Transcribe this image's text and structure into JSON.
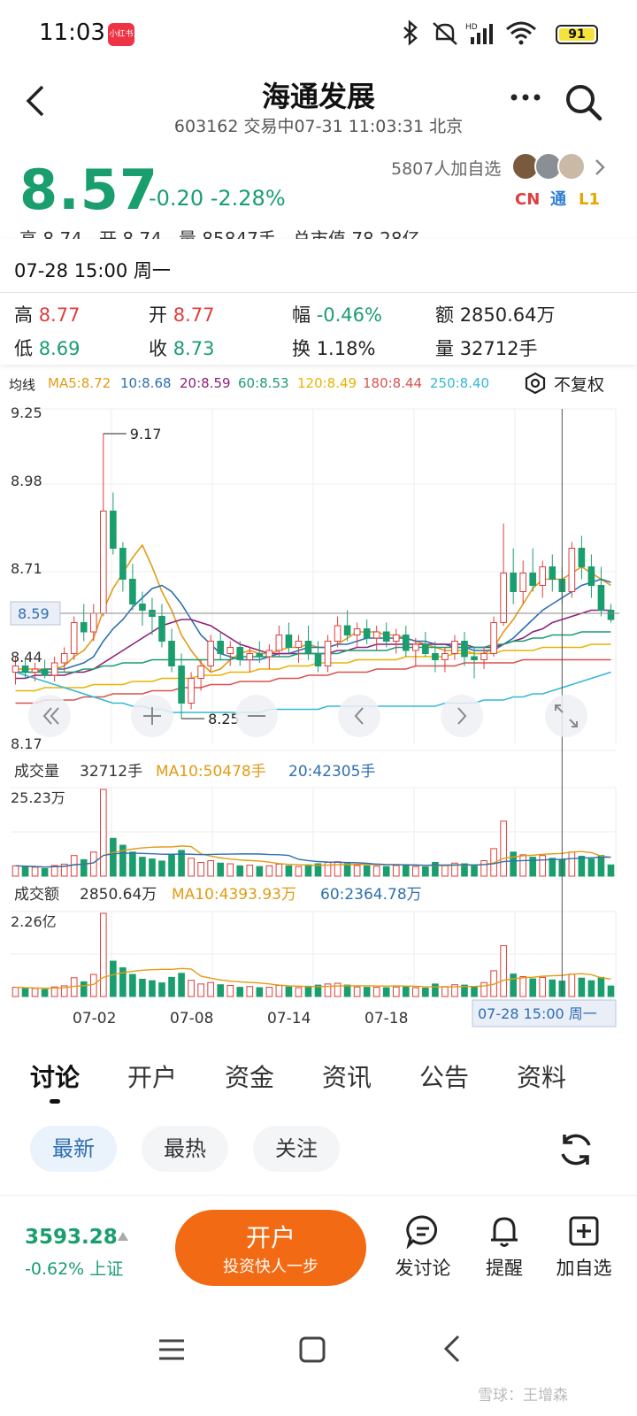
{
  "status_bar": {
    "time": "11:03",
    "app_badge": "小红书",
    "battery": "91"
  },
  "header": {
    "stock_name": "海通发展",
    "subtitle": "603162 交易中07-31 11:03:31 北京"
  },
  "quote": {
    "price": "8.57",
    "change": "-0.20 -2.28%",
    "followers": "5807人加自选",
    "tags": [
      "CN",
      "通",
      "L1"
    ],
    "partial_row": "高 8.74   开 8.74   量 85847手   总市值 78.28亿"
  },
  "info_panel": {
    "date": "07-28 15:00 周一",
    "cells": [
      {
        "label": "高",
        "value": "8.77"
      },
      {
        "label": "开",
        "value": "8.77"
      },
      {
        "label": "幅",
        "value": "-0.46%"
      },
      {
        "label": "额",
        "value": "2850.64万"
      },
      {
        "label": "低",
        "value": "8.69"
      },
      {
        "label": "收",
        "value": "8.73"
      },
      {
        "label": "换",
        "value": "1.18%"
      },
      {
        "label": "量",
        "value": "32712手"
      }
    ]
  },
  "ma_legend": {
    "title": "均线",
    "items": [
      {
        "text": "MA5:8.72",
        "color": "#e39b13"
      },
      {
        "text": "10:8.68",
        "color": "#2f6fb1"
      },
      {
        "text": "20:8.59",
        "color": "#8f1f7a"
      },
      {
        "text": "60:8.53",
        "color": "#1a9e6e"
      },
      {
        "text": "120:8.49",
        "color": "#e8b400"
      },
      {
        "text": "180:8.44",
        "color": "#d9534f"
      },
      {
        "text": "250:8.40",
        "color": "#33b9d6"
      }
    ],
    "adjust_label": "不复权"
  },
  "chart_data": {
    "type": "candlestick",
    "ylim": [
      8.17,
      9.25
    ],
    "y_ticks": [
      "9.25",
      "8.98",
      "8.71",
      "8.44",
      "8.17"
    ],
    "current_price_label": "8.59",
    "current_price": 8.59,
    "high_marker": {
      "label": "9.17",
      "value": 9.17
    },
    "low_marker": {
      "label": "8.25",
      "value": 8.25
    },
    "x_ticks": [
      "07-02",
      "07-08",
      "07-14",
      "07-18"
    ],
    "crosshair_label": "07-28 15:00 周一",
    "candles": [
      [
        8.4,
        8.45,
        8.36,
        8.42
      ],
      [
        8.42,
        8.44,
        8.38,
        8.4
      ],
      [
        8.4,
        8.43,
        8.37,
        8.41
      ],
      [
        8.41,
        8.44,
        8.38,
        8.39
      ],
      [
        8.39,
        8.45,
        8.37,
        8.43
      ],
      [
        8.43,
        8.48,
        8.4,
        8.46
      ],
      [
        8.46,
        8.58,
        8.44,
        8.56
      ],
      [
        8.56,
        8.62,
        8.5,
        8.53
      ],
      [
        8.53,
        8.62,
        8.5,
        8.59
      ],
      [
        8.59,
        9.17,
        8.58,
        8.92
      ],
      [
        8.92,
        8.98,
        8.78,
        8.8
      ],
      [
        8.8,
        8.82,
        8.66,
        8.7
      ],
      [
        8.7,
        8.75,
        8.6,
        8.62
      ],
      [
        8.62,
        8.66,
        8.55,
        8.6
      ],
      [
        8.6,
        8.64,
        8.52,
        8.58
      ],
      [
        8.58,
        8.62,
        8.48,
        8.5
      ],
      [
        8.5,
        8.54,
        8.4,
        8.42
      ],
      [
        8.42,
        8.46,
        8.25,
        8.3
      ],
      [
        8.3,
        8.4,
        8.28,
        8.38
      ],
      [
        8.38,
        8.44,
        8.34,
        8.42
      ],
      [
        8.42,
        8.52,
        8.4,
        8.5
      ],
      [
        8.5,
        8.53,
        8.44,
        8.46
      ],
      [
        8.46,
        8.5,
        8.42,
        8.48
      ],
      [
        8.48,
        8.5,
        8.42,
        8.44
      ],
      [
        8.44,
        8.48,
        8.4,
        8.46
      ],
      [
        8.46,
        8.5,
        8.43,
        8.45
      ],
      [
        8.45,
        8.49,
        8.41,
        8.47
      ],
      [
        8.47,
        8.55,
        8.45,
        8.52
      ],
      [
        8.52,
        8.56,
        8.46,
        8.48
      ],
      [
        8.48,
        8.52,
        8.43,
        8.5
      ],
      [
        8.5,
        8.55,
        8.44,
        8.46
      ],
      [
        8.46,
        8.5,
        8.4,
        8.42
      ],
      [
        8.42,
        8.52,
        8.4,
        8.5
      ],
      [
        8.5,
        8.58,
        8.48,
        8.55
      ],
      [
        8.55,
        8.6,
        8.5,
        8.52
      ],
      [
        8.52,
        8.56,
        8.48,
        8.54
      ],
      [
        8.54,
        8.57,
        8.49,
        8.51
      ],
      [
        8.51,
        8.55,
        8.47,
        8.53
      ],
      [
        8.53,
        8.56,
        8.48,
        8.5
      ],
      [
        8.5,
        8.54,
        8.46,
        8.52
      ],
      [
        8.52,
        8.55,
        8.45,
        8.47
      ],
      [
        8.47,
        8.51,
        8.42,
        8.49
      ],
      [
        8.49,
        8.53,
        8.45,
        8.46
      ],
      [
        8.46,
        8.5,
        8.4,
        8.44
      ],
      [
        8.44,
        8.48,
        8.4,
        8.46
      ],
      [
        8.46,
        8.52,
        8.44,
        8.5
      ],
      [
        8.5,
        8.53,
        8.42,
        8.45
      ],
      [
        8.45,
        8.48,
        8.38,
        8.44
      ],
      [
        8.44,
        8.48,
        8.41,
        8.46
      ],
      [
        8.46,
        8.58,
        8.45,
        8.56
      ],
      [
        8.56,
        8.88,
        8.55,
        8.72
      ],
      [
        8.72,
        8.8,
        8.62,
        8.66
      ],
      [
        8.66,
        8.76,
        8.62,
        8.72
      ],
      [
        8.72,
        8.8,
        8.66,
        8.68
      ],
      [
        8.68,
        8.76,
        8.64,
        8.74
      ],
      [
        8.74,
        8.78,
        8.66,
        8.7
      ],
      [
        8.7,
        8.74,
        8.62,
        8.66
      ],
      [
        8.66,
        8.82,
        8.64,
        8.8
      ],
      [
        8.8,
        8.84,
        8.7,
        8.74
      ],
      [
        8.74,
        8.78,
        8.64,
        8.68
      ],
      [
        8.68,
        8.74,
        8.58,
        8.6
      ],
      [
        8.6,
        8.62,
        8.56,
        8.57
      ]
    ],
    "ma_lines": [
      {
        "name": "MA5",
        "color": "#e39b13",
        "values": [
          8.41,
          8.41,
          8.41,
          8.41,
          8.41,
          8.42,
          8.45,
          8.47,
          8.51,
          8.6,
          8.67,
          8.72,
          8.77,
          8.81,
          8.74,
          8.66,
          8.6,
          8.52,
          8.47,
          8.43,
          8.4,
          8.41,
          8.44,
          8.46,
          8.47,
          8.46,
          8.46,
          8.47,
          8.48,
          8.48,
          8.49,
          8.48,
          8.48,
          8.49,
          8.51,
          8.53,
          8.53,
          8.53,
          8.52,
          8.52,
          8.51,
          8.5,
          8.49,
          8.48,
          8.47,
          8.47,
          8.47,
          8.46,
          8.46,
          8.48,
          8.53,
          8.57,
          8.62,
          8.67,
          8.7,
          8.7,
          8.7,
          8.72,
          8.74,
          8.72,
          8.7,
          8.68
        ]
      },
      {
        "name": "MA10",
        "color": "#2f6fb1",
        "values": [
          8.4,
          8.4,
          8.4,
          8.41,
          8.41,
          8.41,
          8.42,
          8.43,
          8.45,
          8.5,
          8.54,
          8.57,
          8.61,
          8.64,
          8.67,
          8.68,
          8.66,
          8.62,
          8.57,
          8.52,
          8.49,
          8.46,
          8.45,
          8.44,
          8.44,
          8.44,
          8.45,
          8.46,
          8.46,
          8.47,
          8.48,
          8.48,
          8.48,
          8.49,
          8.49,
          8.5,
          8.51,
          8.51,
          8.51,
          8.51,
          8.51,
          8.5,
          8.5,
          8.49,
          8.49,
          8.48,
          8.48,
          8.47,
          8.47,
          8.47,
          8.49,
          8.51,
          8.54,
          8.57,
          8.6,
          8.62,
          8.64,
          8.66,
          8.68,
          8.69,
          8.7,
          8.69
        ]
      },
      {
        "name": "MA20",
        "color": "#8f1f7a",
        "values": [
          8.38,
          8.38,
          8.39,
          8.39,
          8.39,
          8.39,
          8.4,
          8.4,
          8.41,
          8.43,
          8.45,
          8.47,
          8.49,
          8.51,
          8.53,
          8.55,
          8.56,
          8.57,
          8.57,
          8.56,
          8.55,
          8.53,
          8.51,
          8.49,
          8.48,
          8.47,
          8.46,
          8.46,
          8.46,
          8.46,
          8.46,
          8.46,
          8.46,
          8.47,
          8.47,
          8.48,
          8.48,
          8.49,
          8.49,
          8.49,
          8.49,
          8.49,
          8.49,
          8.49,
          8.49,
          8.49,
          8.49,
          8.48,
          8.48,
          8.48,
          8.49,
          8.5,
          8.51,
          8.53,
          8.54,
          8.56,
          8.57,
          8.58,
          8.59,
          8.6,
          8.6,
          8.6
        ]
      },
      {
        "name": "MA60",
        "color": "#1a9e6e",
        "values": [
          8.4,
          8.4,
          8.4,
          8.4,
          8.4,
          8.4,
          8.4,
          8.41,
          8.41,
          8.42,
          8.42,
          8.43,
          8.43,
          8.43,
          8.44,
          8.44,
          8.44,
          8.44,
          8.44,
          8.44,
          8.44,
          8.44,
          8.44,
          8.45,
          8.45,
          8.45,
          8.45,
          8.45,
          8.45,
          8.46,
          8.46,
          8.46,
          8.46,
          8.46,
          8.47,
          8.47,
          8.47,
          8.47,
          8.47,
          8.48,
          8.48,
          8.48,
          8.48,
          8.48,
          8.48,
          8.48,
          8.48,
          8.48,
          8.48,
          8.49,
          8.49,
          8.5,
          8.5,
          8.51,
          8.51,
          8.52,
          8.52,
          8.52,
          8.53,
          8.53,
          8.53,
          8.53
        ]
      },
      {
        "name": "MA120",
        "color": "#e8b400",
        "values": [
          8.34,
          8.34,
          8.34,
          8.35,
          8.35,
          8.35,
          8.35,
          8.35,
          8.36,
          8.36,
          8.36,
          8.36,
          8.37,
          8.37,
          8.37,
          8.38,
          8.38,
          8.38,
          8.38,
          8.39,
          8.39,
          8.39,
          8.4,
          8.4,
          8.4,
          8.41,
          8.41,
          8.41,
          8.42,
          8.42,
          8.42,
          8.43,
          8.43,
          8.43,
          8.43,
          8.44,
          8.44,
          8.44,
          8.44,
          8.44,
          8.45,
          8.45,
          8.45,
          8.45,
          8.45,
          8.46,
          8.46,
          8.46,
          8.46,
          8.46,
          8.47,
          8.47,
          8.47,
          8.47,
          8.48,
          8.48,
          8.48,
          8.48,
          8.48,
          8.49,
          8.49,
          8.49
        ]
      },
      {
        "name": "MA180",
        "color": "#d9534f",
        "values": [
          8.3,
          8.3,
          8.3,
          8.31,
          8.31,
          8.31,
          8.31,
          8.32,
          8.32,
          8.32,
          8.33,
          8.33,
          8.33,
          8.33,
          8.34,
          8.34,
          8.34,
          8.35,
          8.35,
          8.35,
          8.36,
          8.36,
          8.36,
          8.37,
          8.37,
          8.37,
          8.37,
          8.38,
          8.38,
          8.38,
          8.39,
          8.39,
          8.39,
          8.4,
          8.4,
          8.4,
          8.4,
          8.41,
          8.41,
          8.41,
          8.41,
          8.42,
          8.42,
          8.42,
          8.42,
          8.42,
          8.43,
          8.43,
          8.43,
          8.43,
          8.43,
          8.43,
          8.44,
          8.44,
          8.44,
          8.44,
          8.44,
          8.44,
          8.44,
          8.44,
          8.44,
          8.44
        ]
      },
      {
        "name": "MA250",
        "color": "#33b9d6",
        "values": [
          8.4,
          8.39,
          8.38,
          8.37,
          8.36,
          8.35,
          8.34,
          8.33,
          8.32,
          8.31,
          8.3,
          8.3,
          8.29,
          8.29,
          8.28,
          8.28,
          8.27,
          8.27,
          8.27,
          8.27,
          8.27,
          8.27,
          8.27,
          8.27,
          8.27,
          8.27,
          8.28,
          8.28,
          8.28,
          8.28,
          8.28,
          8.28,
          8.29,
          8.29,
          8.29,
          8.29,
          8.29,
          8.29,
          8.29,
          8.29,
          8.29,
          8.29,
          8.29,
          8.29,
          8.3,
          8.3,
          8.3,
          8.3,
          8.31,
          8.31,
          8.31,
          8.32,
          8.32,
          8.33,
          8.33,
          8.34,
          8.35,
          8.36,
          8.37,
          8.38,
          8.39,
          8.4
        ]
      }
    ],
    "volume": {
      "label": "成交量",
      "current": "32712手",
      "ma10": "MA10:50478手",
      "ma20": "20:42305手",
      "max_label": "25.23万",
      "max": 252300,
      "values": [
        30000,
        28000,
        26000,
        22000,
        31000,
        35000,
        60000,
        48000,
        70000,
        252300,
        110000,
        90000,
        70000,
        55000,
        50000,
        44000,
        62000,
        75000,
        52000,
        40000,
        45000,
        38000,
        36000,
        30000,
        32000,
        28000,
        30000,
        35000,
        30000,
        28000,
        33000,
        36000,
        40000,
        42000,
        36000,
        31000,
        30000,
        29000,
        28000,
        31000,
        30000,
        28000,
        27000,
        40000,
        32000,
        38000,
        36000,
        30000,
        45000,
        80000,
        160000,
        70000,
        62000,
        55000,
        60000,
        52000,
        48000,
        70000,
        58000,
        50000,
        60000,
        32712
      ]
    },
    "amount": {
      "label": "成交额",
      "current": "2850.64万",
      "ma10": "MA10:4393.93万",
      "ma60": "60:2364.78万",
      "max_label": "2.26亿",
      "max": 226000000,
      "values": [
        2500,
        2300,
        2200,
        1900,
        2600,
        2900,
        5100,
        4000,
        6000,
        22600,
        9600,
        7800,
        6000,
        4700,
        4300,
        3700,
        5200,
        6300,
        4400,
        3400,
        3800,
        3200,
        3000,
        2500,
        2700,
        2400,
        2500,
        3000,
        2600,
        2400,
        2800,
        3100,
        3400,
        3600,
        3100,
        2600,
        2500,
        2500,
        2400,
        2600,
        2600,
        2400,
        2300,
        3400,
        2700,
        3200,
        3100,
        2600,
        3800,
        7000,
        13800,
        6100,
        5400,
        4800,
        5200,
        4500,
        4200,
        6100,
        5000,
        4300,
        5200,
        2850
      ]
    },
    "crosshair_index": 56
  },
  "tabs": [
    "讨论",
    "开户",
    "资金",
    "资讯",
    "公告",
    "资料"
  ],
  "filters": [
    "最新",
    "最热",
    "关注"
  ],
  "bottom_bar": {
    "index_value": "3593.28",
    "index_change": "-0.62% 上证",
    "open_title": "开户",
    "open_sub": "投资快人一步",
    "actions": [
      "发讨论",
      "提醒",
      "加自选"
    ]
  },
  "watermark": "雪球：王增森"
}
